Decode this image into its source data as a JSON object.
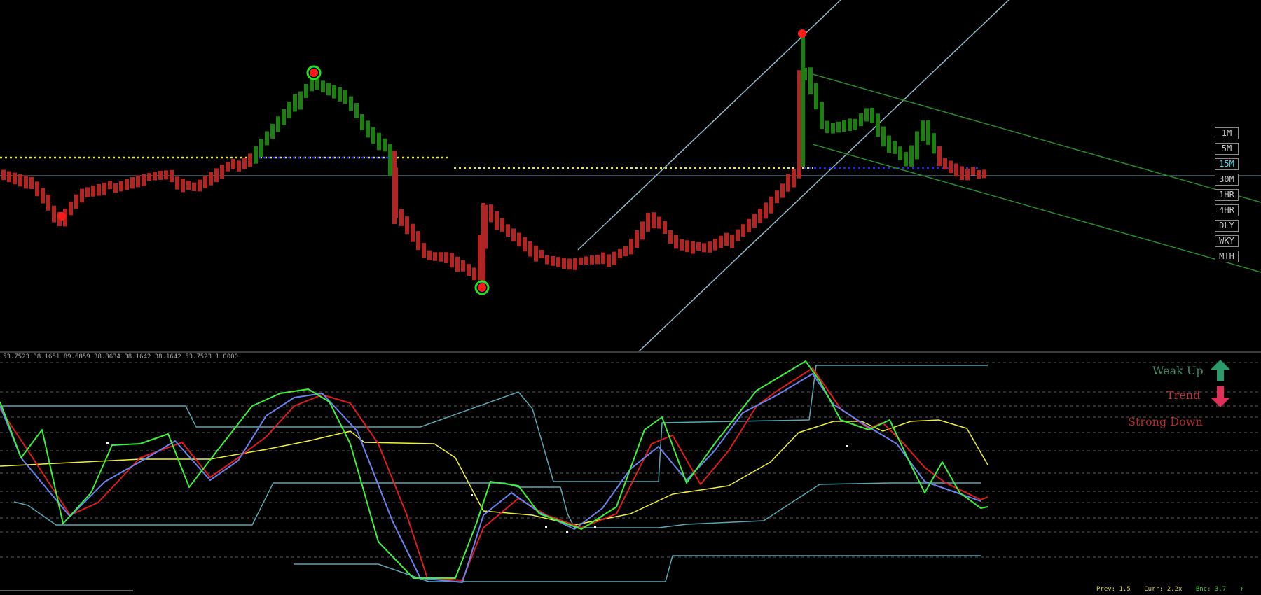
{
  "osc_values_text": "53.7523 38.1651 89.6859 38.8634 38.1642 38.1642 53.7523 1.0000",
  "timeframes": [
    {
      "label": "1M",
      "active": false
    },
    {
      "label": "5M",
      "active": false
    },
    {
      "label": "15M",
      "active": true
    },
    {
      "label": "30M",
      "active": false
    },
    {
      "label": "1HR",
      "active": false
    },
    {
      "label": "4HR",
      "active": false
    },
    {
      "label": "DLY",
      "active": false
    },
    {
      "label": "WKY",
      "active": false
    },
    {
      "label": "MTH",
      "active": false
    }
  ],
  "signal": {
    "line1": "Weak Up",
    "line2": "Trend",
    "line3": "Strong Down",
    "line1_color": "#3d8a6a",
    "line2_color": "#c0303a",
    "line3_color": "#b02c2c",
    "up_arrow_color": "#2a9a6a",
    "down_arrow_color": "#e0305a",
    "up_arrow_icon": "arrow-up-icon",
    "down_arrow_icon": "arrow-down-icon"
  },
  "status": {
    "prev": "Prev: 1.5",
    "curr": "Curr: 2.2x",
    "bnc": "Bnc: 3.7",
    "bnc_icon": "arrow-up-icon"
  },
  "colors": {
    "background": "#000000",
    "bull_bar": "#1e7d12",
    "bear_bar": "#b02424",
    "dotted_level": "#e6e640",
    "blue_dotted": "#1e28ff",
    "channel_line": "#8fbcc9",
    "green_channel": "#2a8a2a",
    "swing_dot": "#ff1a1a",
    "swing_ring": "#22e022",
    "osc_fast": "#3cf03c",
    "osc_slow": "#e01c1c",
    "osc_signal": "#6a82f0",
    "osc_baseline": "#f0f03c",
    "osc_band": "#5aa6b6",
    "grid": "#5a5a5a"
  }
}
